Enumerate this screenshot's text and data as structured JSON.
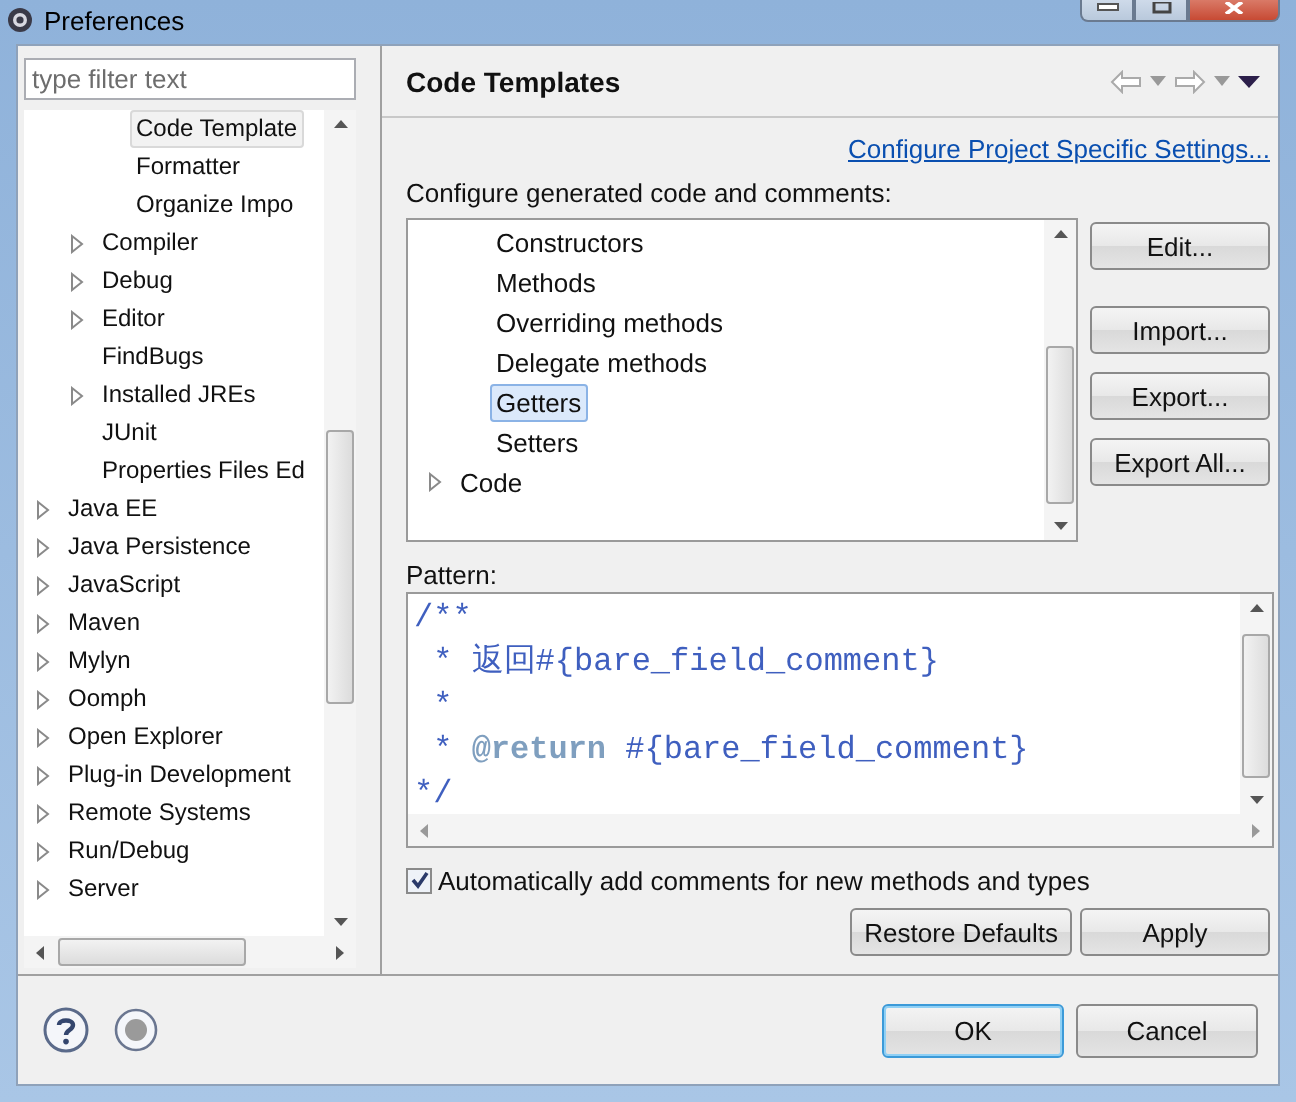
{
  "window": {
    "title": "Preferences"
  },
  "filter": {
    "placeholder": "type filter text"
  },
  "nav_tree": [
    {
      "children": [
        {
          "children": [
            {
              "label": "Code Template",
              "kind": "leaf",
              "selected": true
            },
            {
              "label": "Formatter",
              "kind": "leaf",
              "selected": false
            },
            {
              "label": "Organize Impo",
              "kind": "leaf",
              "selected": false
            }
          ]
        },
        {
          "label": "Compiler",
          "kind": "collapsed",
          "selected": false
        },
        {
          "label": "Debug",
          "kind": "collapsed",
          "selected": false
        },
        {
          "label": "Editor",
          "kind": "collapsed",
          "selected": false
        },
        {
          "label": "FindBugs",
          "kind": "leaf",
          "selected": false
        },
        {
          "label": "Installed JREs",
          "kind": "collapsed",
          "selected": false
        },
        {
          "label": "JUnit",
          "kind": "leaf",
          "selected": false
        },
        {
          "label": "Properties Files Ed",
          "kind": "leaf",
          "selected": false
        }
      ]
    },
    {
      "label": "Java EE",
      "kind": "collapsed",
      "selected": false
    },
    {
      "label": "Java Persistence",
      "kind": "collapsed",
      "selected": false
    },
    {
      "label": "JavaScript",
      "kind": "collapsed",
      "selected": false
    },
    {
      "label": "Maven",
      "kind": "collapsed",
      "selected": false
    },
    {
      "label": "Mylyn",
      "kind": "collapsed",
      "selected": false
    },
    {
      "label": "Oomph",
      "kind": "collapsed",
      "selected": false
    },
    {
      "label": "Open Explorer",
      "kind": "collapsed",
      "selected": false
    },
    {
      "label": "Plug-in Development",
      "kind": "collapsed",
      "selected": false
    },
    {
      "label": "Remote Systems",
      "kind": "collapsed",
      "selected": false
    },
    {
      "label": "Run/Debug",
      "kind": "collapsed",
      "selected": false
    },
    {
      "label": "Server",
      "kind": "collapsed",
      "selected": false
    }
  ],
  "page": {
    "title": "Code Templates",
    "link": "Configure Project Specific Settings...",
    "description": "Configure generated code and comments:",
    "templates": [
      {
        "children": [
          {
            "label": "Constructors",
            "kind": "leaf",
            "selected": false
          },
          {
            "label": "Methods",
            "kind": "leaf",
            "selected": false
          },
          {
            "label": "Overriding methods",
            "kind": "leaf",
            "selected": false
          },
          {
            "label": "Delegate methods",
            "kind": "leaf",
            "selected": false
          },
          {
            "label": "Getters",
            "kind": "leaf",
            "selected": true
          },
          {
            "label": "Setters",
            "kind": "leaf",
            "selected": false
          }
        ]
      },
      {
        "label": "Code",
        "kind": "collapsed",
        "selected": false
      }
    ],
    "side_buttons": [
      "Edit...",
      "Import...",
      "Export...",
      "Export All..."
    ],
    "pattern_label": "Pattern:",
    "pattern_lines": [
      [
        {
          "text": "/**",
          "kind": "comment"
        }
      ],
      [
        {
          "text": " * 返回#{bare_field_comment}",
          "kind": "comment"
        }
      ],
      [
        {
          "text": " *",
          "kind": "comment"
        }
      ],
      [
        {
          "text": " * ",
          "kind": "comment"
        },
        {
          "text": "@return",
          "kind": "tag"
        },
        {
          "text": " #{bare_field_comment}",
          "kind": "comment"
        }
      ],
      [
        {
          "text": "*/",
          "kind": "comment"
        }
      ]
    ],
    "auto_comments": {
      "label": "Automatically add comments for new methods and types",
      "checked": true
    },
    "page_buttons": [
      "Restore Defaults",
      "Apply"
    ]
  },
  "dialog_buttons": [
    {
      "label": "OK",
      "default": true
    },
    {
      "label": "Cancel",
      "default": false
    }
  ]
}
